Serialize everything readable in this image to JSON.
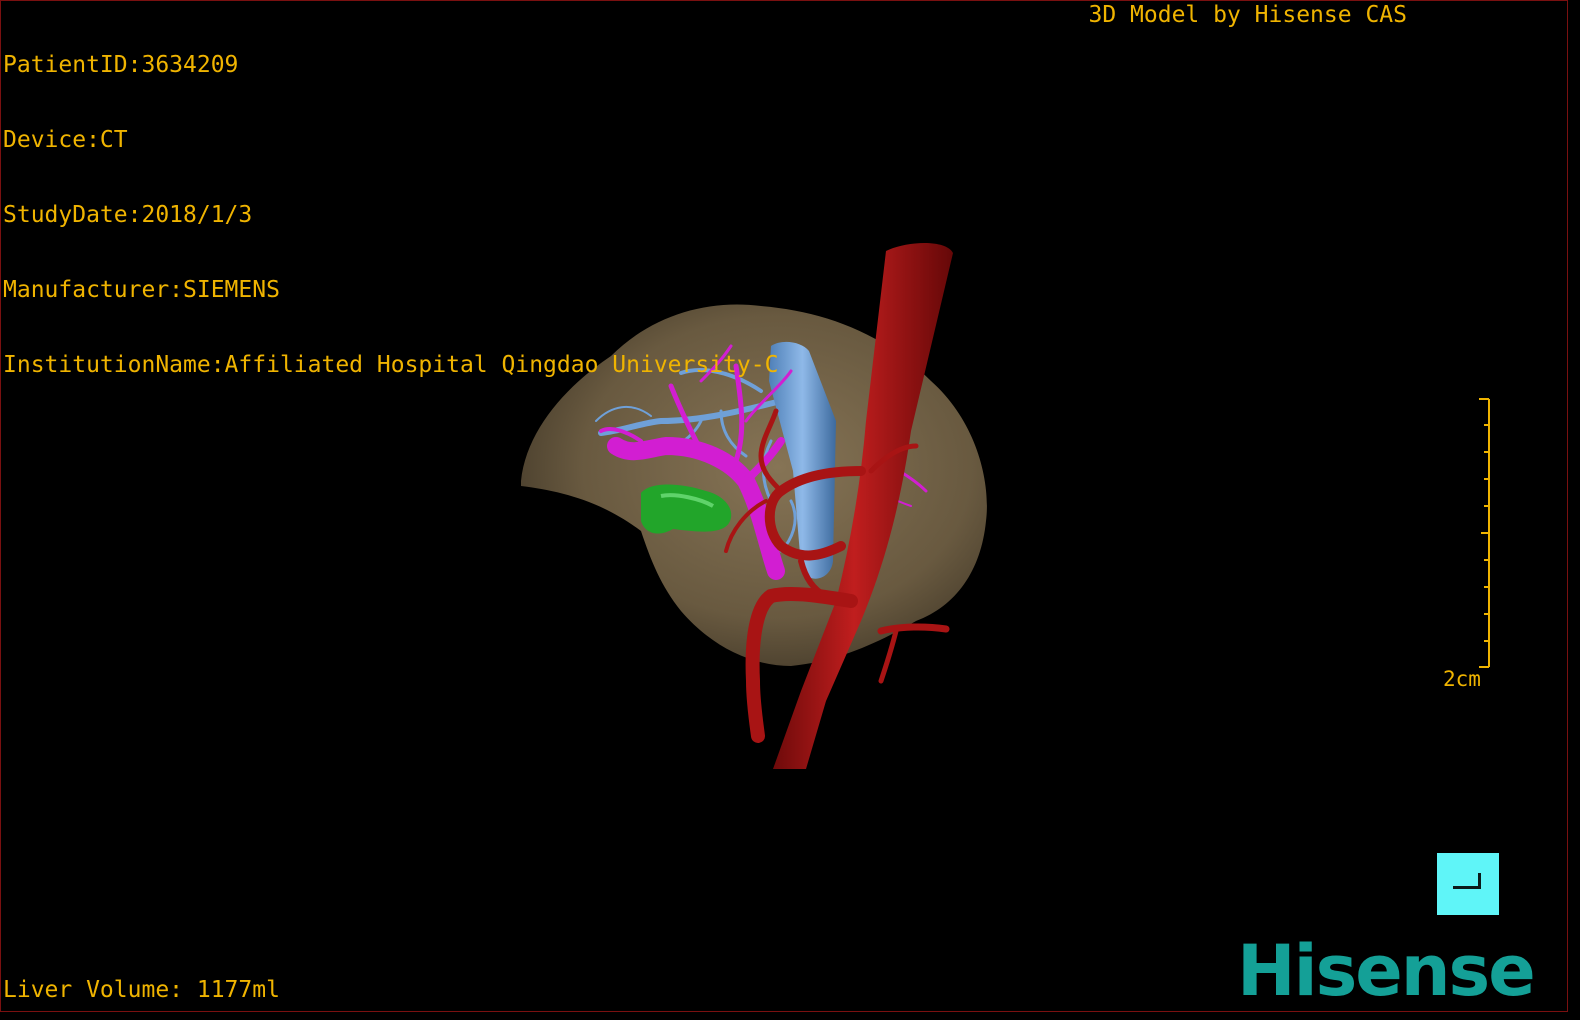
{
  "header": {
    "patient_id": "PatientID:3634209",
    "device": "Device:CT",
    "study_date": "StudyDate:2018/1/3",
    "manufacturer": "Manufacturer:SIEMENS",
    "institution": "InstitutionName:Affiliated Hospital Qingdao University-C"
  },
  "branding": {
    "title": "3D Model by Hisense CAS",
    "logo": "Hisense"
  },
  "scale": {
    "label": "2cm"
  },
  "footer": {
    "liver_volume": "Liver Volume: 1177ml"
  },
  "colors": {
    "overlay_text": "#f0b400",
    "liver": "#7d6a4c",
    "hepatic_vein": "#6fa0d8",
    "portal_vein": "#d21ed2",
    "artery": "#a81414",
    "gallbladder": "#22a52a",
    "corner_button": "#5ff5f8",
    "logo": "#14a097"
  },
  "icons": {
    "corner_button": "corner-bracket-icon"
  }
}
